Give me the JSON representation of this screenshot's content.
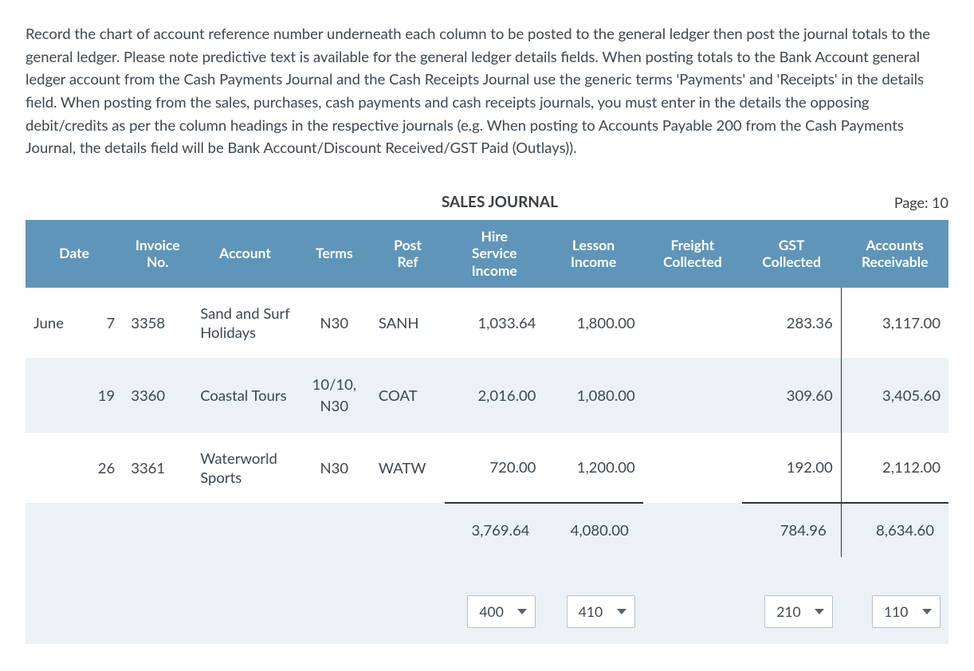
{
  "instructions": "Record the chart of account reference number underneath each column to be posted to the general ledger then post the journal totals to the general ledger. Please note predictive text is available for the general ledger details fields. When posting totals to the Bank Account general ledger account from the Cash Payments Journal and the Cash Receipts Journal use the generic terms 'Payments' and 'Receipts' in the details field. When posting from the sales, purchases, cash payments and cash receipts journals, you must enter in the details the opposing debit/credits as per the column headings in the respective journals (e.g. When posting to Accounts Payable 200 from the Cash Payments Journal, the details field will be Bank Account/Discount Received/GST Paid (Outlays)).",
  "journal": {
    "title": "SALES JOURNAL",
    "page_label": "Page: 10",
    "headers": {
      "date": "Date",
      "invoice_no": "Invoice No.",
      "account": "Account",
      "terms": "Terms",
      "post_ref": "Post Ref",
      "hire_service_income": "Hire Service Income",
      "lesson_income": "Lesson Income",
      "freight_collected": "Freight Collected",
      "gst_collected": "GST Collected",
      "accounts_receivable": "Accounts Receivable"
    },
    "rows": [
      {
        "month": "June",
        "day": "7",
        "invoice_no": "3358",
        "account": "Sand and Surf Holidays",
        "terms": "N30",
        "post_ref": "SANH",
        "hire_service_income": "1,033.64",
        "lesson_income": "1,800.00",
        "freight_collected": "",
        "gst_collected": "283.36",
        "accounts_receivable": "3,117.00"
      },
      {
        "month": "",
        "day": "19",
        "invoice_no": "3360",
        "account": "Coastal Tours",
        "terms": "10/10, N30",
        "post_ref": "COAT",
        "hire_service_income": "2,016.00",
        "lesson_income": "1,080.00",
        "freight_collected": "",
        "gst_collected": "309.60",
        "accounts_receivable": "3,405.60"
      },
      {
        "month": "",
        "day": "26",
        "invoice_no": "3361",
        "account": "Waterworld Sports",
        "terms": "N30",
        "post_ref": "WATW",
        "hire_service_income": "720.00",
        "lesson_income": "1,200.00",
        "freight_collected": "",
        "gst_collected": "192.00",
        "accounts_receivable": "2,112.00"
      }
    ],
    "totals": {
      "hire_service_income": "3,769.64",
      "lesson_income": "4,080.00",
      "freight_collected": "",
      "gst_collected": "784.96",
      "accounts_receivable": "8,634.60"
    },
    "refs": {
      "hire_service_income": "400",
      "lesson_income": "410",
      "freight_collected": "",
      "gst_collected": "210",
      "accounts_receivable": "110"
    }
  }
}
